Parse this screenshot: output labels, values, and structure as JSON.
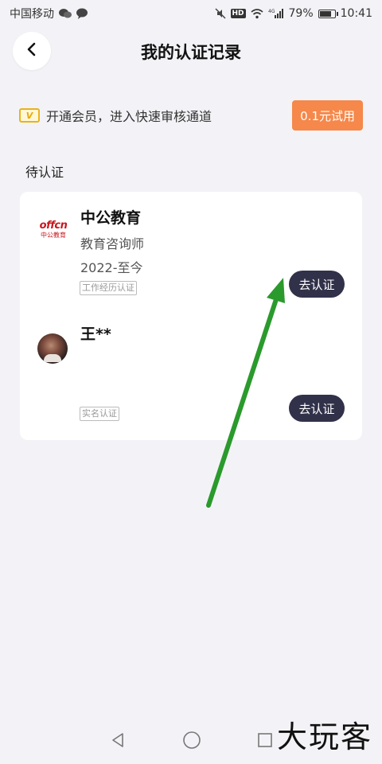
{
  "status_bar": {
    "carrier": "中国移动",
    "network": "4G",
    "battery": "79%",
    "battery_level": 0.79,
    "time": "10:41",
    "icons": [
      "wechat-icon",
      "message-icon",
      "mute-icon",
      "hd-icon",
      "wifi-icon",
      "signal-icon",
      "battery-icon"
    ]
  },
  "header": {
    "title": "我的认证记录",
    "back_icon": "chevron-left-icon"
  },
  "vip_banner": {
    "icon_text": "V",
    "text": "开通会员，进入快速审核通道",
    "trial_label": "0.1元试用",
    "trial_color": "#f5884a"
  },
  "section": {
    "title": "待认证"
  },
  "entries": [
    {
      "logo_text": "offcn",
      "logo_sub": "中公教育",
      "name": "中公教育",
      "role": "教育咨询师",
      "period": "2022-至今",
      "tag": "工作经历认证",
      "action": "去认证"
    },
    {
      "name": "王**",
      "tag": "实名认证",
      "action": "去认证"
    }
  ],
  "colors": {
    "accent_button": "#31314a",
    "annotation_arrow": "#2a9a2c",
    "background": "#f3f3f7"
  },
  "watermark": "大玩客"
}
